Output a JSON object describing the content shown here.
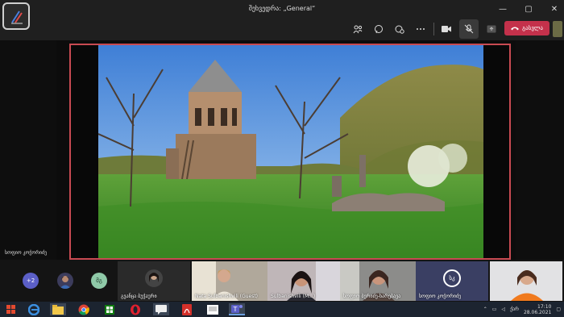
{
  "window": {
    "title": "შეხვედრა: „General“",
    "controls": [
      "—",
      "▢",
      "✕"
    ]
  },
  "toolbar": {
    "leave_label": "გასვლა",
    "icons": [
      "people-icon",
      "chat-icon",
      "reactions-icon",
      "more-icon",
      "camera-icon",
      "mic-off-icon",
      "share-icon"
    ]
  },
  "stage": {
    "left_participant_name": "სოფიო კოჭორიძე"
  },
  "participants": {
    "overflow_count": "+2",
    "initials_mk": "მგ",
    "initials_sk": "სკ",
    "tiles": [
      {
        "name": "გვანცა ბუჭაური"
      },
      {
        "name": "Nata Sulbanishvili (Guest)"
      },
      {
        "name": "Sulbanishvili (M...)"
      },
      {
        "name": "სოფიო ბერიძე-ხარებავა"
      },
      {
        "name": "სოფიო კოჭორიძე"
      },
      {
        "name": ""
      }
    ]
  },
  "taskbar": {
    "lang": "ქარ",
    "time": "17:10",
    "date": "28.06.2021"
  },
  "colors": {
    "leave": "#c4314b",
    "share_border": "#c84a52",
    "titlebar": "#1f1f1f"
  }
}
